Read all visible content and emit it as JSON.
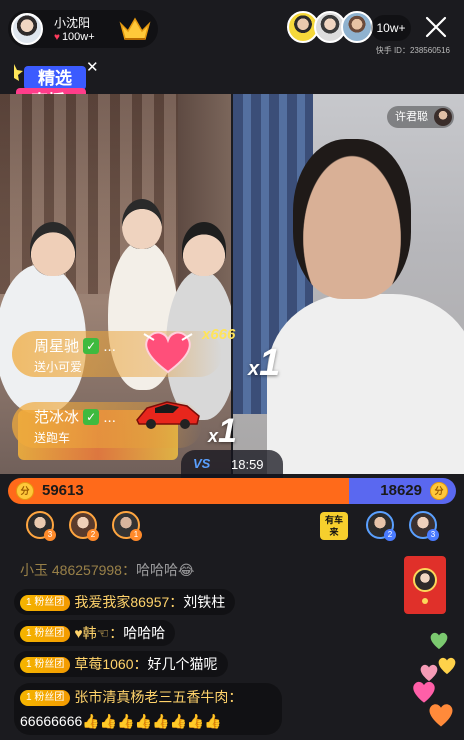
{
  "host": {
    "name": "小沈阳",
    "likes": "100w+"
  },
  "viewers": {
    "count": "10w+",
    "id_label": "快手 ID：238560516"
  },
  "feature_badge": {
    "line1": "精选",
    "line2": "直播"
  },
  "guest": {
    "name": "许君聪"
  },
  "gifts": [
    {
      "sender": "周星驰",
      "action": "送小可爱",
      "multiplier": "x666"
    },
    {
      "sender": "范冰冰",
      "action": "送跑车"
    }
  ],
  "multipliers": {
    "right": "1",
    "left": "1"
  },
  "pk": {
    "timer": "18:59",
    "vs": "VS",
    "left_score": "59613",
    "right_score": "18629",
    "coin_label": "分"
  },
  "contributors": {
    "left": [
      {
        "rank": "3"
      },
      {
        "rank": "2"
      },
      {
        "rank": "1"
      }
    ],
    "right": [
      {
        "rank": "2"
      },
      {
        "rank": "3"
      }
    ],
    "promo": "有车 来"
  },
  "comments": [
    {
      "user": "小玉 486257998",
      "text": "哈哈哈😂"
    },
    {
      "badge": "1 粉丝团",
      "user": "我爱我家86957",
      "text": "刘铁柱"
    },
    {
      "badge": "1 粉丝团",
      "user": "♥韩☜",
      "text": "哈哈哈"
    },
    {
      "badge": "1 粉丝团",
      "user": "草莓1060",
      "text": "好几个猫呢"
    },
    {
      "badge": "1 粉丝团",
      "user": "张市清真杨老三五香牛肉",
      "text": "66666666👍👍👍👍👍👍👍👍"
    }
  ],
  "colors": {
    "pk_left": "#ff6a1a",
    "pk_right": "#5a68f0",
    "fan_badge": "#f5a800",
    "red_packet": "#e0302a"
  },
  "icons": [
    "heart-icon",
    "crown-icon",
    "close-icon",
    "coin-icon",
    "check-icon"
  ]
}
